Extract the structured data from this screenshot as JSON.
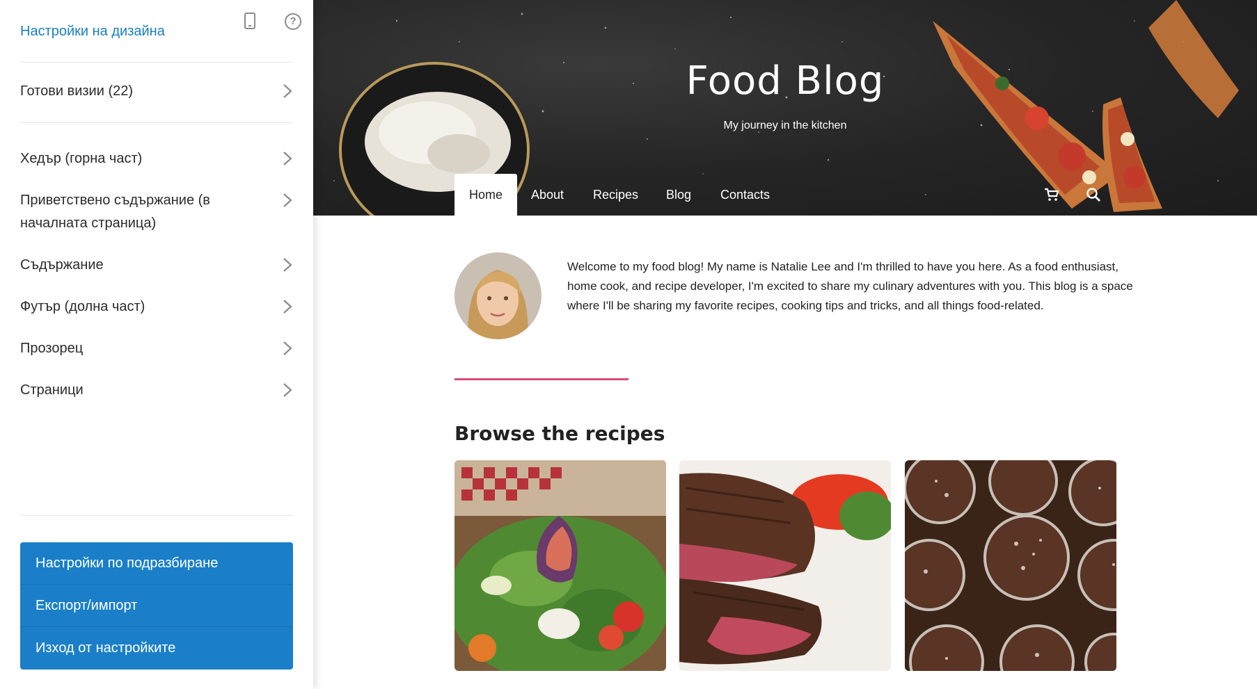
{
  "sidebar": {
    "title": "Настройки на дизайна",
    "icons": {
      "device": "mobile-phone-icon",
      "help": "help-question-icon"
    },
    "items": [
      {
        "label": "Готови визии (22)"
      },
      {
        "label": "Хедър (горна част)"
      },
      {
        "label": "Приветствено съдържание (в началната страница)"
      },
      {
        "label": "Съдържание"
      },
      {
        "label": "Футър (долна част)"
      },
      {
        "label": "Прозорец"
      },
      {
        "label": "Страници"
      }
    ],
    "buttons": [
      {
        "label": "Настройки по подразбиране"
      },
      {
        "label": "Експорт/импорт"
      },
      {
        "label": "Изход от настройките"
      }
    ],
    "accent_color": "#1a7fc8"
  },
  "site": {
    "title": "Food Blog",
    "subtitle": "My journey in the kitchen",
    "nav": [
      {
        "label": "Home",
        "active": true
      },
      {
        "label": "About"
      },
      {
        "label": "Recipes"
      },
      {
        "label": "Blog"
      },
      {
        "label": "Contacts"
      }
    ],
    "nav_icons": [
      "cart-icon",
      "search-icon"
    ],
    "intro": "Welcome to my food blog! My name is Natalie Lee and I'm thrilled to have you here. As a food enthusiast, home cook, and recipe developer, I'm excited to share my culinary adventures with you. This blog is a space where I'll be sharing my favorite recipes, cooking tips and tricks, and all things food-related.",
    "divider_color": "#d44e7c",
    "section_title": "Browse the recipes",
    "recipes": [
      {
        "image": "salad-with-figs-image"
      },
      {
        "image": "grilled-steak-image"
      },
      {
        "image": "chocolate-muffins-image"
      }
    ]
  }
}
